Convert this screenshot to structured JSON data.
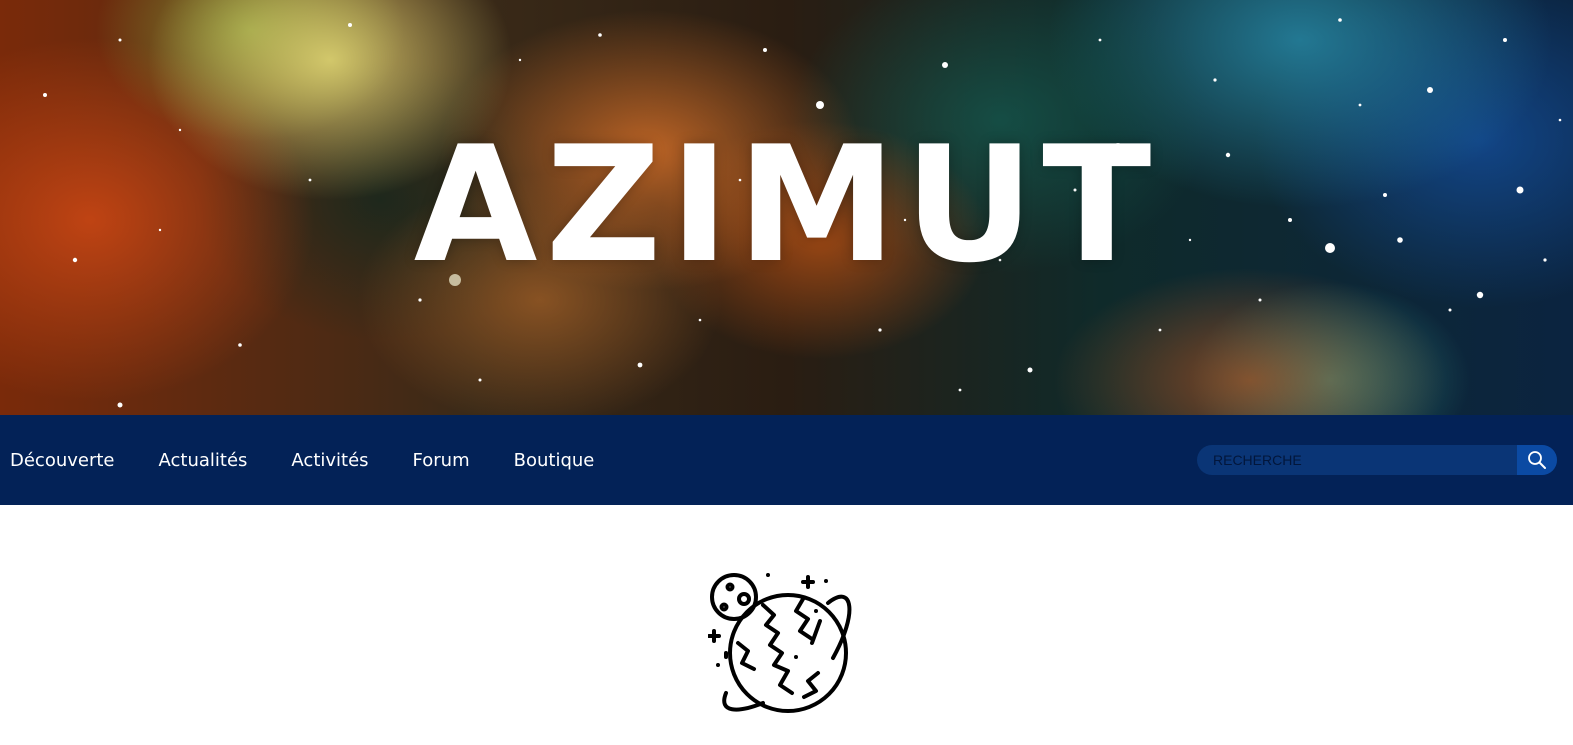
{
  "site": {
    "title": "AZIMUT"
  },
  "nav": {
    "items": [
      {
        "label": "Découverte"
      },
      {
        "label": "Actualités"
      },
      {
        "label": "Activités"
      },
      {
        "label": "Forum"
      },
      {
        "label": "Boutique"
      }
    ]
  },
  "search": {
    "placeholder": "RECHERCHE",
    "value": "",
    "icon": "search-icon"
  },
  "content": {
    "icon": "planet-space-icon"
  },
  "colors": {
    "nav_background": "#032257",
    "search_background": "#0a3576",
    "search_button": "#0b4aa3",
    "text_light": "#ffffff"
  }
}
